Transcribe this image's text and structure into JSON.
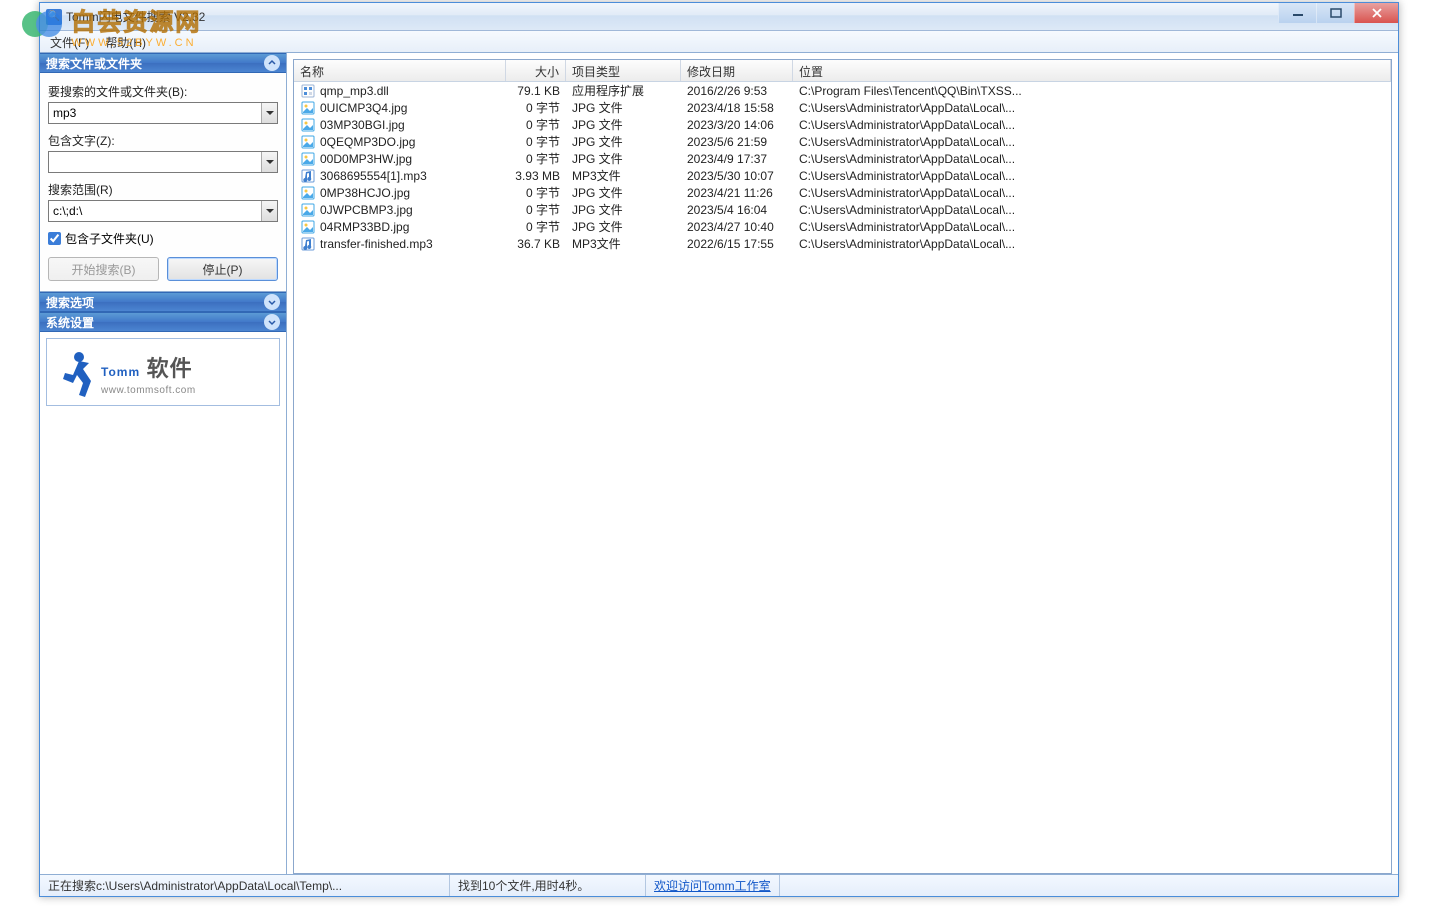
{
  "watermark": {
    "cn": "白芸资源网",
    "url": "WWW.52BYW.CN"
  },
  "window": {
    "title": "Tomm闪电文件搜索 V2.32"
  },
  "menu": {
    "file": "文件(F)",
    "help": "帮助(H)"
  },
  "sidebar": {
    "panel_search": {
      "title": "搜索文件或文件夹"
    },
    "label_target": "要搜索的文件或文件夹(B):",
    "value_target": "mp3",
    "label_contains": "包含文字(Z):",
    "value_contains": "",
    "label_scope": "搜索范围(R)",
    "value_scope": "c:\\;d:\\",
    "check_subfolders": "包含子文件夹(U)",
    "check_subfolders_checked": true,
    "btn_start": "开始搜索(B)",
    "btn_stop": "停止(P)",
    "panel_options": {
      "title": "搜索选项"
    },
    "panel_system": {
      "title": "系统设置"
    },
    "logo": {
      "brand_en": "Tomm",
      "brand_cn": "软件",
      "url": "www.tommsoft.com"
    }
  },
  "columns": {
    "name": "名称",
    "size": "大小",
    "type": "项目类型",
    "date": "修改日期",
    "location": "位置"
  },
  "rows": [
    {
      "icon": "dll",
      "name": "qmp_mp3.dll",
      "size": "79.1 KB",
      "type": "应用程序扩展",
      "date": "2016/2/26 9:53",
      "loc": "C:\\Program Files\\Tencent\\QQ\\Bin\\TXSS..."
    },
    {
      "icon": "jpg",
      "name": "0UICMP3Q4.jpg",
      "size": "0 字节",
      "type": "JPG 文件",
      "date": "2023/4/18 15:58",
      "loc": "C:\\Users\\Administrator\\AppData\\Local\\..."
    },
    {
      "icon": "jpg",
      "name": "03MP30BGI.jpg",
      "size": "0 字节",
      "type": "JPG 文件",
      "date": "2023/3/20 14:06",
      "loc": "C:\\Users\\Administrator\\AppData\\Local\\..."
    },
    {
      "icon": "jpg",
      "name": "0QEQMP3DO.jpg",
      "size": "0 字节",
      "type": "JPG 文件",
      "date": "2023/5/6 21:59",
      "loc": "C:\\Users\\Administrator\\AppData\\Local\\..."
    },
    {
      "icon": "jpg",
      "name": "00D0MP3HW.jpg",
      "size": "0 字节",
      "type": "JPG 文件",
      "date": "2023/4/9 17:37",
      "loc": "C:\\Users\\Administrator\\AppData\\Local\\..."
    },
    {
      "icon": "mp3",
      "name": "3068695554[1].mp3",
      "size": "3.93 MB",
      "type": "MP3文件",
      "date": "2023/5/30 10:07",
      "loc": "C:\\Users\\Administrator\\AppData\\Local\\..."
    },
    {
      "icon": "jpg",
      "name": "0MP38HCJO.jpg",
      "size": "0 字节",
      "type": "JPG 文件",
      "date": "2023/4/21 11:26",
      "loc": "C:\\Users\\Administrator\\AppData\\Local\\..."
    },
    {
      "icon": "jpg",
      "name": "0JWPCBMP3.jpg",
      "size": "0 字节",
      "type": "JPG 文件",
      "date": "2023/5/4 16:04",
      "loc": "C:\\Users\\Administrator\\AppData\\Local\\..."
    },
    {
      "icon": "jpg",
      "name": "04RMP33BD.jpg",
      "size": "0 字节",
      "type": "JPG 文件",
      "date": "2023/4/27 10:40",
      "loc": "C:\\Users\\Administrator\\AppData\\Local\\..."
    },
    {
      "icon": "mp3",
      "name": "transfer-finished.mp3",
      "size": "36.7 KB",
      "type": "MP3文件",
      "date": "2022/6/15 17:55",
      "loc": "C:\\Users\\Administrator\\AppData\\Local\\..."
    }
  ],
  "status": {
    "left": "正在搜索c:\\Users\\Administrator\\AppData\\Local\\Temp\\...",
    "mid": "找到10个文件,用时4秒。",
    "link": "欢迎访问Tomm工作室"
  }
}
